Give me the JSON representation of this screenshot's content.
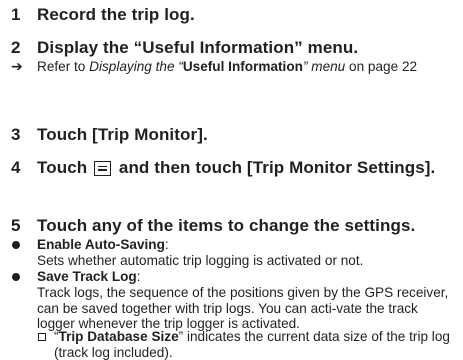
{
  "steps": [
    {
      "num": "1",
      "text": "Record the trip log."
    },
    {
      "num": "2",
      "text": "Display the “Useful Information” menu."
    },
    {
      "num": "3",
      "text": "Touch [Trip Monitor]."
    },
    {
      "num": "4",
      "text_before_icon": "Touch",
      "icon": "menu-icon",
      "text_after_icon": "and then touch [Trip Monitor Settings]."
    },
    {
      "num": "5",
      "text": "Touch any of the items to change the settings."
    }
  ],
  "reference": {
    "arrow": "➔",
    "prefix": "Refer to ",
    "italic_a": "Displaying the “",
    "bold": "Useful Information",
    "italic_b": "” menu",
    "suffix": " on page 22"
  },
  "items": [
    {
      "title": "Enable Auto-Saving",
      "colon": ":",
      "description": "Sets whether automatic trip logging is activated or not."
    },
    {
      "title": "Save Track Log",
      "colon": ":",
      "description": "Track logs, the sequence of the positions given by the GPS receiver, can be saved together with trip logs. You can acti-vate the track logger whenever the trip logger is activated."
    }
  ],
  "note": {
    "open_quote": "“",
    "bold": "Trip Database Size",
    "rest": "” indicates the current data size of the trip log (track log included)."
  }
}
